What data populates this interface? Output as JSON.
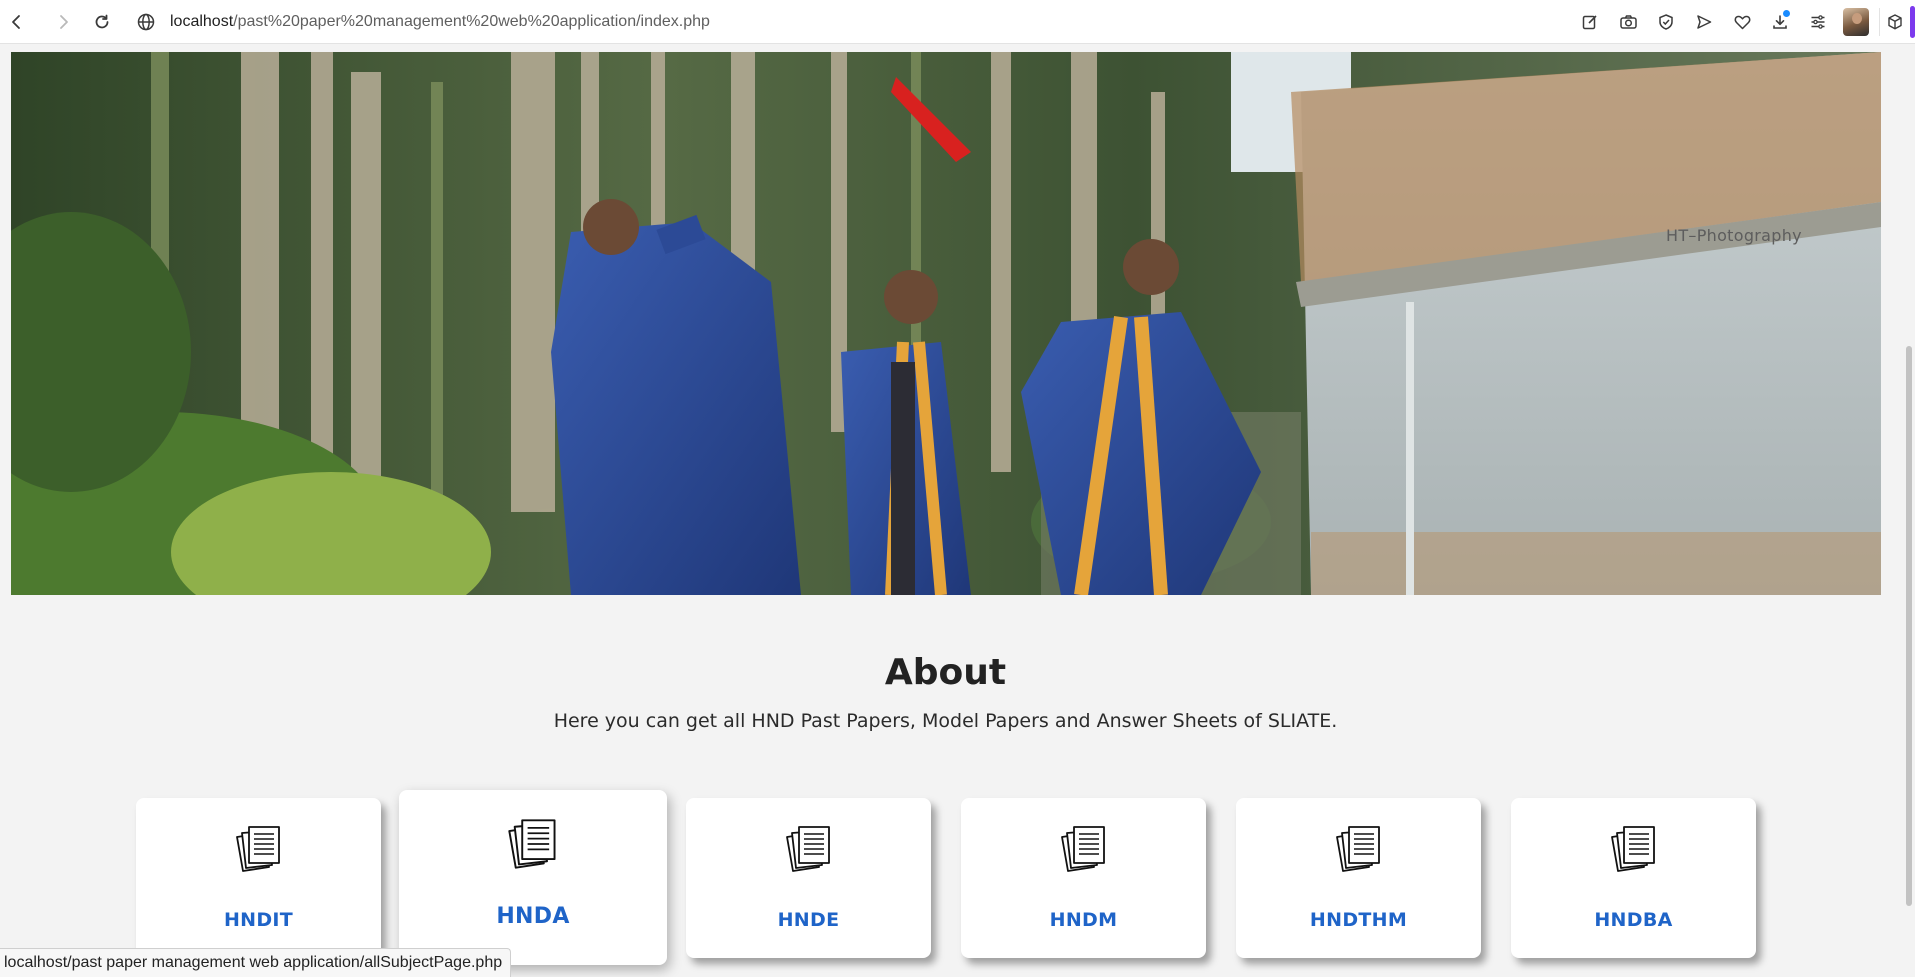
{
  "browser": {
    "url_host": "localhost",
    "url_path": "/past%20paper%20management%20web%20application/index.php",
    "status_url": "localhost/past paper management web application/allSubjectPage.php",
    "accent_color": "#7c3aed"
  },
  "hero": {
    "watermark": "HT–Photography"
  },
  "about": {
    "title": "About",
    "description": "Here you can get all HND Past Papers, Model Papers and Answer Sheets of SLIATE."
  },
  "cards": [
    {
      "label": "HNDIT",
      "icon": "papers-icon"
    },
    {
      "label": "HNDA",
      "icon": "papers-icon"
    },
    {
      "label": "HNDE",
      "icon": "papers-icon"
    },
    {
      "label": "HNDM",
      "icon": "papers-icon"
    },
    {
      "label": "HNDTHM",
      "icon": "papers-icon"
    },
    {
      "label": "HNDBA",
      "icon": "papers-icon"
    }
  ],
  "colors": {
    "card_label": "#1f64c8",
    "page_background": "#f3f3f3"
  }
}
